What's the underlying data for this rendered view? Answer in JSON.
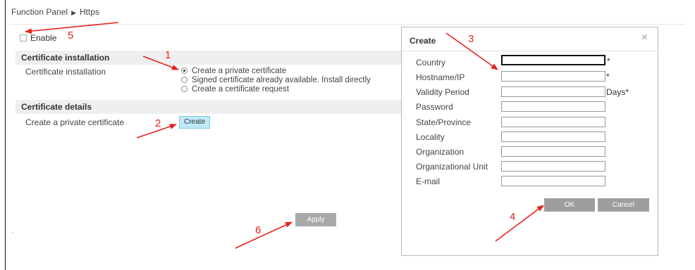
{
  "breadcrumb": {
    "root": "Function Panel",
    "separator": "▶",
    "current": "Https"
  },
  "enable": {
    "label": "Enable",
    "checked": false
  },
  "sections": {
    "installation": {
      "title": "Certificate installation",
      "row_label": "Certificate installation",
      "options": [
        {
          "label": "Create a private certificate",
          "checked": true
        },
        {
          "label": "Signed certificate already available. Install directly",
          "checked": false
        },
        {
          "label": "Create a certificate request",
          "checked": false
        }
      ]
    },
    "details": {
      "title": "Certificate details",
      "row_label": "Create a private certificate",
      "create_button": "Create"
    }
  },
  "apply_button": "Apply",
  "dialog": {
    "title": "Create",
    "close_glyph": "×",
    "fields": [
      {
        "label": "Country",
        "value": "",
        "suffix": "*"
      },
      {
        "label": "Hostname/IP",
        "value": "",
        "suffix": "*"
      },
      {
        "label": "Validity Period",
        "value": "",
        "suffix": "Days*"
      },
      {
        "label": "Password",
        "value": "",
        "suffix": ""
      },
      {
        "label": "State/Province",
        "value": "",
        "suffix": ""
      },
      {
        "label": "Locality",
        "value": "",
        "suffix": ""
      },
      {
        "label": "Organization",
        "value": "",
        "suffix": ""
      },
      {
        "label": "Organizational Unit",
        "value": "",
        "suffix": ""
      },
      {
        "label": "E-mail",
        "value": "",
        "suffix": ""
      }
    ],
    "ok_button": "OK",
    "cancel_button": "Cancel"
  },
  "annotations": {
    "color": "#e8221b",
    "labels": [
      "1",
      "2",
      "3",
      "4",
      "5",
      "6"
    ]
  },
  "colors": {
    "create_button_bg": "#bfe9f7",
    "gray_button_bg": "#9e9e9e",
    "section_bg": "#efefef"
  }
}
